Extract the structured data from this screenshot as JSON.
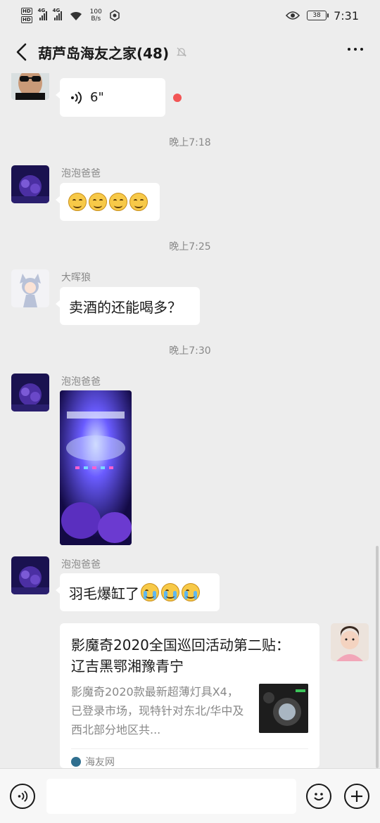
{
  "status_bar": {
    "hd1": "HD",
    "hd2": "HD",
    "sig1": "4G",
    "sig2": "4G",
    "speed_value": "100",
    "speed_unit": "B/s",
    "battery": "38",
    "time": "7:31"
  },
  "nav": {
    "title": "葫芦岛海友之家(48)"
  },
  "messages": {
    "voice_duration": "6\"",
    "ts1": "晚上7:18",
    "sender1": "泡泡爸爸",
    "ts2": "晚上7:25",
    "sender2": "大晖狼",
    "text2": "卖酒的还能喝多？",
    "ts3": "晚上7:30",
    "sender3": "泡泡爸爸",
    "sender4": "泡泡爸爸",
    "text4": "羽毛爆缸了",
    "card": {
      "title": "影魔奇2020全国巡回活动第二贴： 辽吉黑鄂湘豫青宁",
      "desc": "影魔奇2020款最新超薄灯具X4，已登录市场，现特针对东北/华中及西北部分地区共...",
      "source": "海友网"
    }
  },
  "input": {
    "placeholder": ""
  },
  "colors": {
    "background": "#ededed",
    "bubble": "#ffffff",
    "unread": "#f25555",
    "meta_text": "#888888"
  }
}
